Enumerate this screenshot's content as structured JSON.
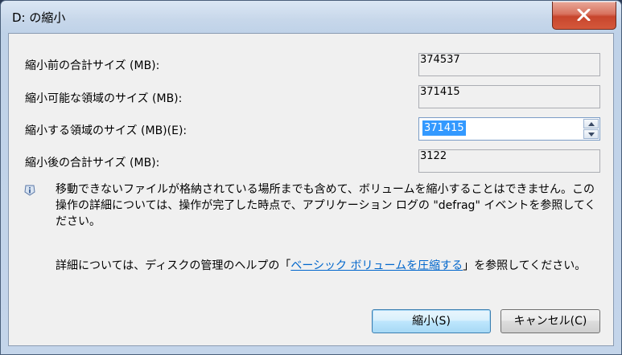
{
  "window": {
    "title": "D: の縮小",
    "close_icon": "close-icon"
  },
  "fields": {
    "total_before_label": "縮小前の合計サイズ (MB):",
    "total_before_value": "374537",
    "available_label": "縮小可能な領域のサイズ (MB):",
    "available_value": "371415",
    "shrink_amount_label": "縮小する領域のサイズ (MB)(E):",
    "shrink_amount_value": "371415",
    "total_after_label": "縮小後の合計サイズ (MB):",
    "total_after_value": "3122"
  },
  "info": {
    "icon": "info-icon",
    "text": "移動できないファイルが格納されている場所までも含めて、ボリュームを縮小することはできません。この操作の詳細については、操作が完了した時点で、アプリケーション ログの \"defrag\" イベントを参照してください。"
  },
  "help": {
    "prefix": "詳細については、ディスクの管理のヘルプの「",
    "link": "ベーシック ボリュームを圧縮する",
    "suffix": "」を参照してください。"
  },
  "buttons": {
    "shrink": "縮小(S)",
    "cancel": "キャンセル(C)"
  },
  "colors": {
    "selection": "#3399ff",
    "link": "#0066cc",
    "close_button": "#c7452c"
  }
}
